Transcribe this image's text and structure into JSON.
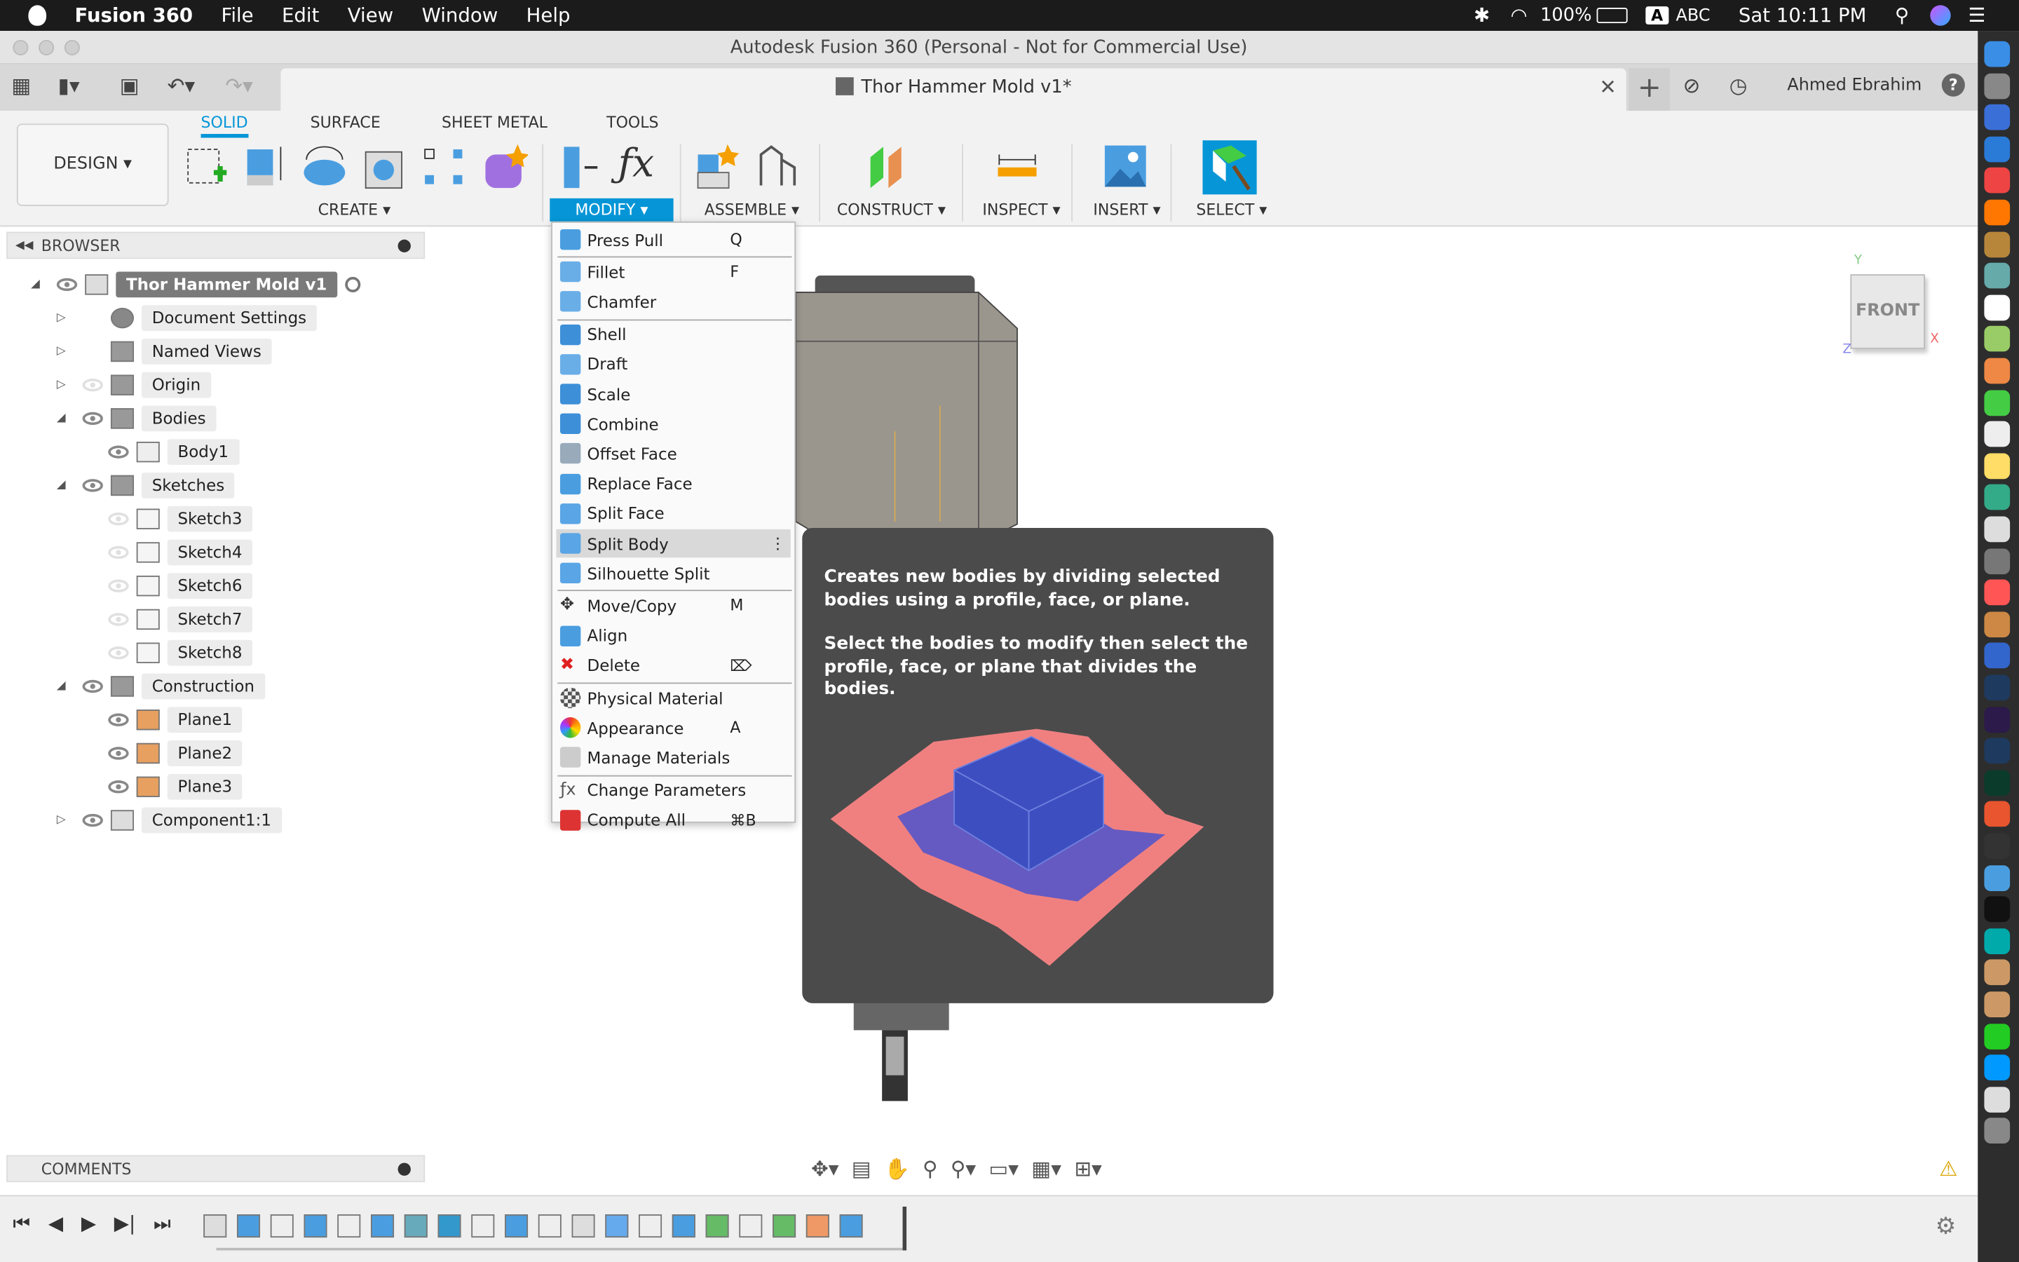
{
  "macos_menubar": {
    "apple": "",
    "app": "Fusion 360",
    "menus": [
      "File",
      "Edit",
      "View",
      "Window",
      "Help"
    ],
    "battery": "100%",
    "input": "ABC",
    "input_badge": "A",
    "clock": "Sat 10:11 PM"
  },
  "window": {
    "title": "Autodesk Fusion 360 (Personal - Not for Commercial Use)",
    "doc_tab": "Thor Hammer Mold v1*",
    "user": "Ahmed Ebrahim",
    "help": "?"
  },
  "ribbon": {
    "workspace": "DESIGN ▾",
    "tabs": [
      "SOLID",
      "SURFACE",
      "SHEET METAL",
      "TOOLS"
    ],
    "active_tab": "SOLID",
    "groups": [
      "CREATE ▾",
      "MODIFY ▾",
      "ASSEMBLE ▾",
      "CONSTRUCT ▾",
      "INSPECT ▾",
      "INSERT ▾",
      "SELECT ▾"
    ],
    "active_group": "MODIFY ▾",
    "accent": "#0696d7"
  },
  "browser": {
    "title": "BROWSER",
    "items": [
      {
        "label": "Thor Hammer Mold v1",
        "depth": 0,
        "exp": "◢",
        "eye": "on",
        "icon": "document"
      },
      {
        "label": "Document Settings",
        "depth": 1,
        "exp": "▷",
        "eye": "none",
        "icon": "gear"
      },
      {
        "label": "Named Views",
        "depth": 1,
        "exp": "▷",
        "eye": "none",
        "icon": "folder"
      },
      {
        "label": "Origin",
        "depth": 1,
        "exp": "▷",
        "eye": "off",
        "icon": "folder"
      },
      {
        "label": "Bodies",
        "depth": 1,
        "exp": "◢",
        "eye": "on",
        "icon": "folder"
      },
      {
        "label": "Body1",
        "depth": 2,
        "exp": "",
        "eye": "on",
        "icon": "body"
      },
      {
        "label": "Sketches",
        "depth": 1,
        "exp": "◢",
        "eye": "on",
        "icon": "folder"
      },
      {
        "label": "Sketch3",
        "depth": 2,
        "exp": "",
        "eye": "off",
        "icon": "sketch-locked"
      },
      {
        "label": "Sketch4",
        "depth": 2,
        "exp": "",
        "eye": "off",
        "icon": "sketch-locked"
      },
      {
        "label": "Sketch6",
        "depth": 2,
        "exp": "",
        "eye": "off",
        "icon": "sketch"
      },
      {
        "label": "Sketch7",
        "depth": 2,
        "exp": "",
        "eye": "off",
        "icon": "sketch"
      },
      {
        "label": "Sketch8",
        "depth": 2,
        "exp": "",
        "eye": "off",
        "icon": "sketch"
      },
      {
        "label": "Construction",
        "depth": 1,
        "exp": "◢",
        "eye": "on",
        "icon": "folder"
      },
      {
        "label": "Plane1",
        "depth": 2,
        "exp": "",
        "eye": "on",
        "icon": "plane"
      },
      {
        "label": "Plane2",
        "depth": 2,
        "exp": "",
        "eye": "on",
        "icon": "plane"
      },
      {
        "label": "Plane3",
        "depth": 2,
        "exp": "",
        "eye": "on",
        "icon": "plane"
      },
      {
        "label": "Component1:1",
        "depth": 1,
        "exp": "▷",
        "eye": "on",
        "icon": "component"
      }
    ]
  },
  "modify_menu": {
    "items": [
      {
        "label": "Press Pull",
        "shortcut": "Q",
        "icon": "press-pull",
        "color": "#4a9ee0"
      },
      {
        "sep": true
      },
      {
        "label": "Fillet",
        "shortcut": "F",
        "icon": "fillet",
        "color": "#6aaee8"
      },
      {
        "label": "Chamfer",
        "shortcut": "",
        "icon": "chamfer",
        "color": "#6aaee8"
      },
      {
        "sep": true
      },
      {
        "label": "Shell",
        "shortcut": "",
        "icon": "shell",
        "color": "#3d8fd8"
      },
      {
        "label": "Draft",
        "shortcut": "",
        "icon": "draft",
        "color": "#6aaee8"
      },
      {
        "label": "Scale",
        "shortcut": "",
        "icon": "scale",
        "color": "#3d8fd8"
      },
      {
        "label": "Combine",
        "shortcut": "",
        "icon": "combine",
        "color": "#3d8fd8"
      },
      {
        "label": "Offset Face",
        "shortcut": "",
        "icon": "offset-face",
        "color": "#9ab"
      },
      {
        "label": "Replace Face",
        "shortcut": "",
        "icon": "replace-face",
        "color": "#4a9ee0"
      },
      {
        "label": "Split Face",
        "shortcut": "",
        "icon": "split-face",
        "color": "#5aa5e5"
      },
      {
        "label": "Split Body",
        "shortcut": "⋮",
        "icon": "split-body",
        "color": "#5aa5e5",
        "highlighted": true
      },
      {
        "label": "Silhouette Split",
        "shortcut": "",
        "icon": "silhouette-split",
        "color": "#5aa5e5"
      },
      {
        "sep": true
      },
      {
        "label": "Move/Copy",
        "shortcut": "M",
        "icon": "move",
        "color": "#333"
      },
      {
        "label": "Align",
        "shortcut": "",
        "icon": "align",
        "color": "#4a9ee0"
      },
      {
        "label": "Delete",
        "shortcut": "⌦",
        "icon": "delete",
        "color": "#e02020"
      },
      {
        "sep": true
      },
      {
        "label": "Physical Material",
        "shortcut": "",
        "icon": "physical-material",
        "color": "#777"
      },
      {
        "label": "Appearance",
        "shortcut": "A",
        "icon": "appearance",
        "color": "#e8a030"
      },
      {
        "label": "Manage Materials",
        "shortcut": "",
        "icon": "manage-materials",
        "color": "#ccc"
      },
      {
        "sep": true
      },
      {
        "label": "Change Parameters",
        "shortcut": "",
        "icon": "fx",
        "color": "#555"
      },
      {
        "label": "Compute All",
        "shortcut": "⌘B",
        "icon": "compute-all",
        "color": "#d33"
      }
    ]
  },
  "tooltip": {
    "line1": "Creates new bodies by dividing selected bodies using a profile, face, or plane.",
    "line2": "Select the bodies to modify then select the profile, face, or plane that divides the bodies."
  },
  "viewcube": {
    "face": "FRONT",
    "x": "X",
    "y": "Y",
    "z": "Z"
  },
  "comments": {
    "title": "COMMENTS"
  }
}
